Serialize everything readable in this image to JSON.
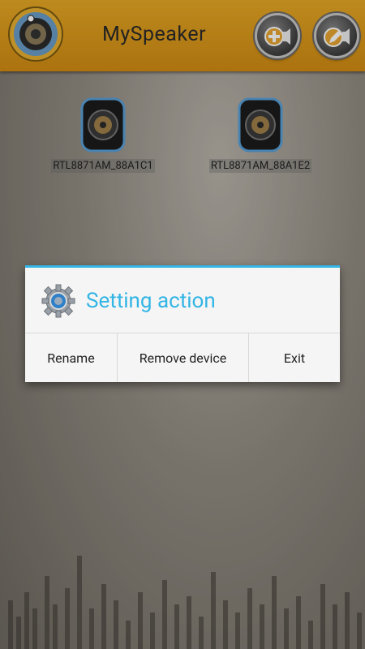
{
  "header": {
    "title": "MySpeaker",
    "icons": [
      "app-logo-icon",
      "add-speaker-icon",
      "edit-speaker-icon"
    ]
  },
  "devices": [
    {
      "label": "RTL8871AM_88A1C1",
      "icon": "speaker-icon"
    },
    {
      "label": "RTL8871AM_88A1E2",
      "icon": "speaker-icon"
    }
  ],
  "dialog": {
    "title": "Setting action",
    "icon": "gear-icon",
    "actions": [
      "Rename",
      "Remove device",
      "Exit"
    ]
  },
  "colors": {
    "header": "#dc9a1c",
    "accent": "#33b5e5",
    "dialog_bg": "#f5f5f5"
  }
}
